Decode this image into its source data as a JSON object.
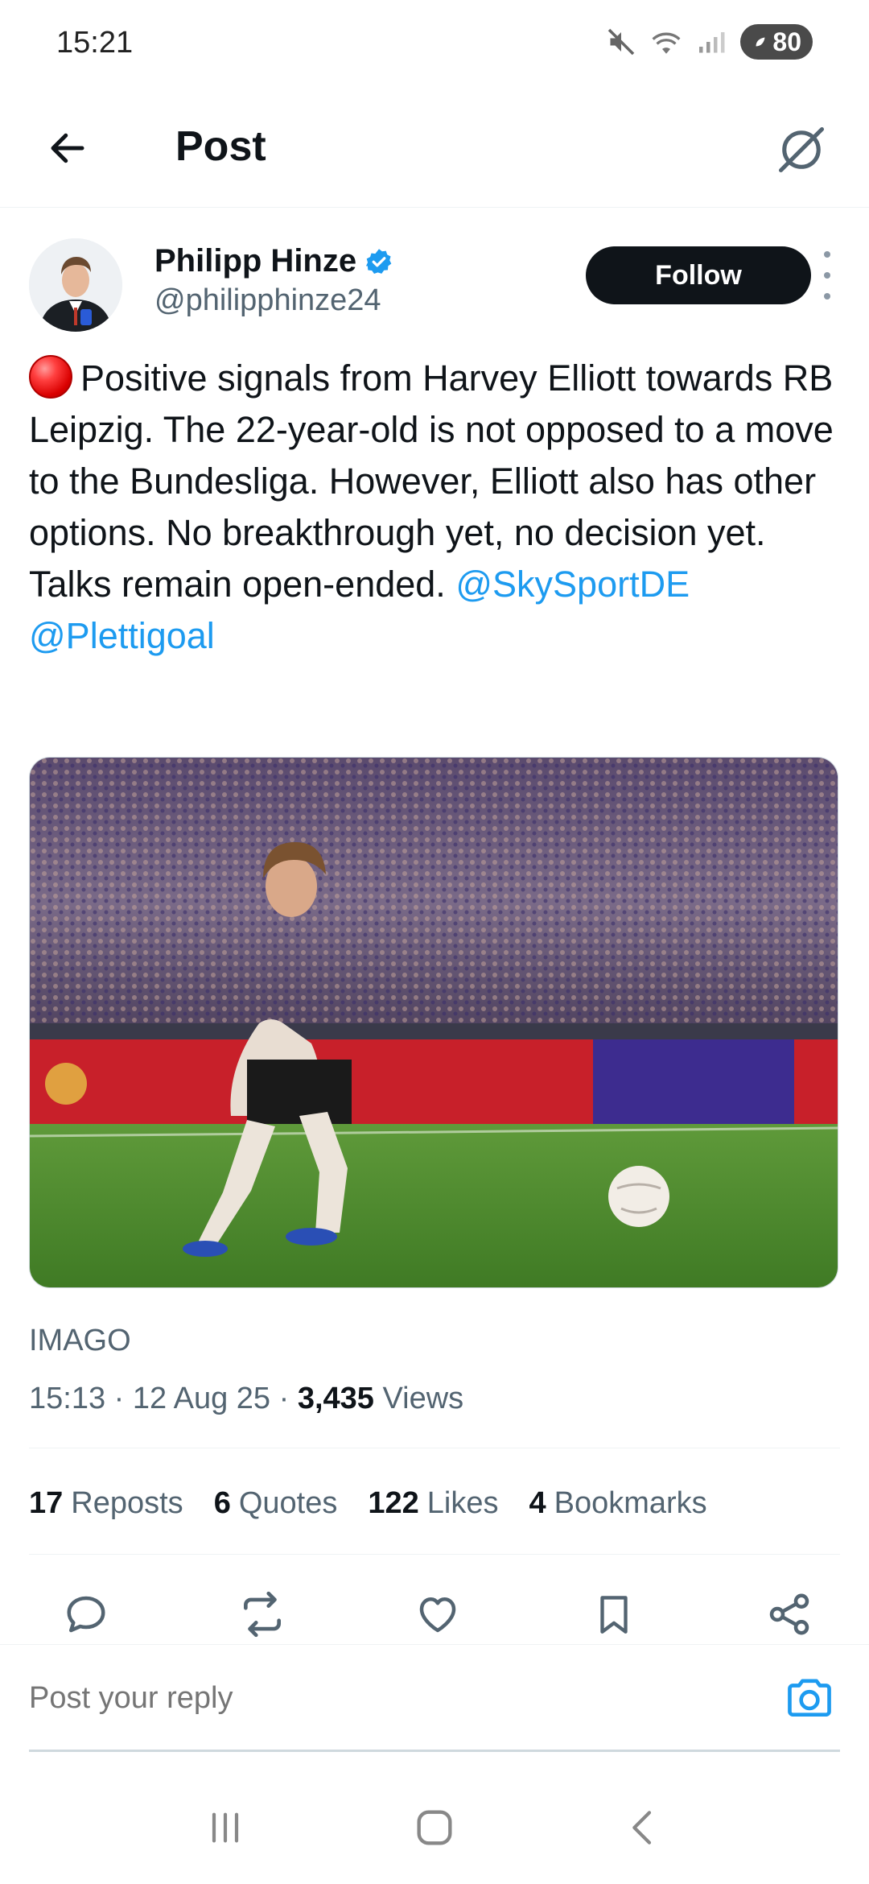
{
  "status_bar": {
    "time": "15:21",
    "battery": "80"
  },
  "header": {
    "title": "Post"
  },
  "author": {
    "name": "Philipp Hinze",
    "handle": "@philipphinze24",
    "verified": true,
    "follow_label": "Follow"
  },
  "post": {
    "emoji": "red-circle",
    "text": "Positive signals from Harvey Elliott towards RB Leipzig. The 22-year-old is not opposed to a move to the Bundesliga. However, Elliott also has other options. No breakthrough yet, no decision yet. Talks remain open-ended.",
    "mention_1": "@SkySportDE",
    "mention_2": "@Plettigoal",
    "media_caption": "IMAGO",
    "time": "15:13",
    "date": "12 Aug 25",
    "views_count": "3,435",
    "views_label": "Views"
  },
  "stats": {
    "reposts_count": "17",
    "reposts_label": "Reposts",
    "quotes_count": "6",
    "quotes_label": "Quotes",
    "likes_count": "122",
    "likes_label": "Likes",
    "bookmarks_count": "4",
    "bookmarks_label": "Bookmarks"
  },
  "reply": {
    "placeholder": "Post your reply"
  },
  "colors": {
    "accent": "#1d9bf0",
    "text_primary": "#0f1419",
    "text_secondary": "#536471"
  }
}
